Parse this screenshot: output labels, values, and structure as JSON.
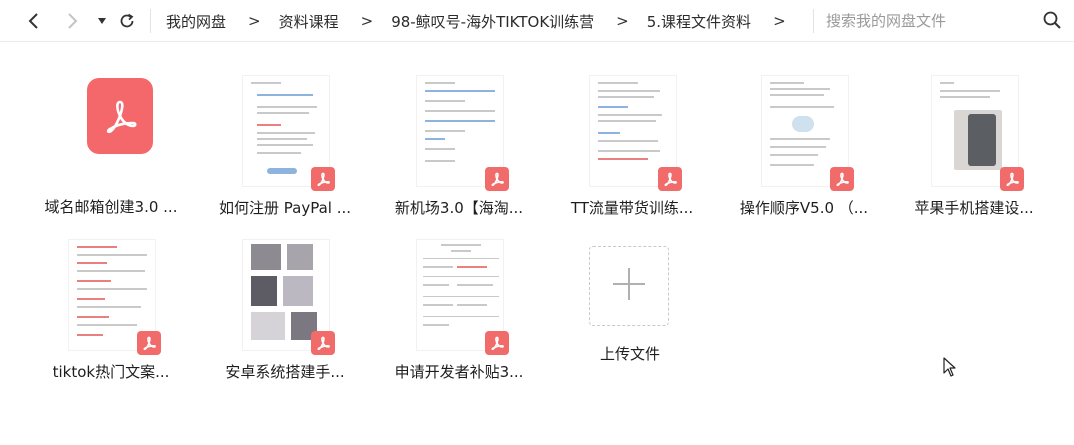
{
  "toolbar": {
    "back_icon": "chevron-left-icon",
    "forward_icon": "chevron-right-icon",
    "history_icon": "caret-down-icon",
    "refresh_icon": "refresh-icon",
    "breadcrumbs": [
      "我的网盘",
      "资料课程",
      "98-鲸叹号-海外TIKTOK训练营",
      "5.课程文件资料"
    ],
    "separator": ">",
    "search_placeholder": "搜索我的网盘文件",
    "search_icon": "search-icon"
  },
  "files": [
    {
      "name": "域名邮箱创建3.0 ...",
      "type": "pdf"
    },
    {
      "name": "如何注册 PayPal ...",
      "type": "pdf"
    },
    {
      "name": "新机场3.0【海淘...",
      "type": "pdf"
    },
    {
      "name": "TT流量带货训练...",
      "type": "pdf"
    },
    {
      "name": "操作顺序V5.0 （...",
      "type": "pdf"
    },
    {
      "name": "苹果手机搭建设...",
      "type": "pdf"
    },
    {
      "name": "tiktok热门文案...",
      "type": "pdf"
    },
    {
      "name": "安卓系统搭建手...",
      "type": "pdf"
    },
    {
      "name": "申请开发者补贴3...",
      "type": "pdf"
    }
  ],
  "upload": {
    "label": "上传文件",
    "icon": "plus-icon"
  },
  "colors": {
    "pdf_red": "#f26b6b",
    "pdf_big": "#f4676a",
    "text": "#1e1e1e",
    "placeholder": "#9a9a9a"
  }
}
